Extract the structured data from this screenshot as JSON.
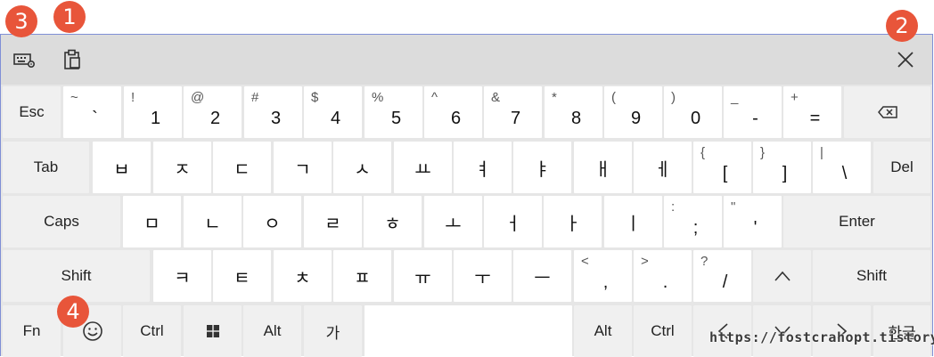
{
  "titlebar": {
    "settings_icon": "keyboard-settings-icon",
    "clipboard_icon": "clipboard-icon",
    "close_icon": "close-icon"
  },
  "badges": [
    "3",
    "1",
    "2",
    "4"
  ],
  "rows": [
    [
      {
        "type": "label",
        "text": "Esc"
      },
      {
        "type": "char",
        "sub": "~",
        "main": "`"
      },
      {
        "type": "char",
        "sub": "!",
        "main": "1"
      },
      {
        "type": "char",
        "sub": "@",
        "main": "2"
      },
      {
        "type": "char",
        "sub": "#",
        "main": "3"
      },
      {
        "type": "char",
        "sub": "$",
        "main": "4"
      },
      {
        "type": "char",
        "sub": "%",
        "main": "5"
      },
      {
        "type": "char",
        "sub": "^",
        "main": "6"
      },
      {
        "type": "char",
        "sub": "&",
        "main": "7"
      },
      {
        "type": "char",
        "sub": "*",
        "main": "8"
      },
      {
        "type": "char",
        "sub": "(",
        "main": "9"
      },
      {
        "type": "char",
        "sub": ")",
        "main": "0"
      },
      {
        "type": "char",
        "sub": "_",
        "main": "-"
      },
      {
        "type": "char",
        "sub": "+",
        "main": "="
      },
      {
        "type": "icon",
        "icon": "backspace-icon"
      }
    ],
    [
      {
        "type": "label",
        "text": "Tab"
      },
      {
        "type": "char",
        "sub": "",
        "main": "ㅂ"
      },
      {
        "type": "char",
        "sub": "",
        "main": "ㅈ"
      },
      {
        "type": "char",
        "sub": "",
        "main": "ㄷ"
      },
      {
        "type": "char",
        "sub": "",
        "main": "ㄱ"
      },
      {
        "type": "char",
        "sub": "",
        "main": "ㅅ"
      },
      {
        "type": "char",
        "sub": "",
        "main": "ㅛ"
      },
      {
        "type": "char",
        "sub": "",
        "main": "ㅕ"
      },
      {
        "type": "char",
        "sub": "",
        "main": "ㅑ"
      },
      {
        "type": "char",
        "sub": "",
        "main": "ㅐ"
      },
      {
        "type": "char",
        "sub": "",
        "main": "ㅔ"
      },
      {
        "type": "char",
        "sub": "{",
        "main": "["
      },
      {
        "type": "char",
        "sub": "}",
        "main": "]"
      },
      {
        "type": "char",
        "sub": "|",
        "main": "\\"
      },
      {
        "type": "label",
        "text": "Del"
      }
    ],
    [
      {
        "type": "label",
        "text": "Caps"
      },
      {
        "type": "char",
        "sub": "",
        "main": "ㅁ"
      },
      {
        "type": "char",
        "sub": "",
        "main": "ㄴ"
      },
      {
        "type": "char",
        "sub": "",
        "main": "ㅇ"
      },
      {
        "type": "char",
        "sub": "",
        "main": "ㄹ"
      },
      {
        "type": "char",
        "sub": "",
        "main": "ㅎ"
      },
      {
        "type": "char",
        "sub": "",
        "main": "ㅗ"
      },
      {
        "type": "char",
        "sub": "",
        "main": "ㅓ"
      },
      {
        "type": "char",
        "sub": "",
        "main": "ㅏ"
      },
      {
        "type": "char",
        "sub": "",
        "main": "ㅣ"
      },
      {
        "type": "char",
        "sub": ":",
        "main": ";"
      },
      {
        "type": "char",
        "sub": "\"",
        "main": "'"
      },
      {
        "type": "label",
        "text": "Enter"
      }
    ],
    [
      {
        "type": "label",
        "text": "Shift"
      },
      {
        "type": "char",
        "sub": "",
        "main": "ㅋ"
      },
      {
        "type": "char",
        "sub": "",
        "main": "ㅌ"
      },
      {
        "type": "char",
        "sub": "",
        "main": "ㅊ"
      },
      {
        "type": "char",
        "sub": "",
        "main": "ㅍ"
      },
      {
        "type": "char",
        "sub": "",
        "main": "ㅠ"
      },
      {
        "type": "char",
        "sub": "",
        "main": "ㅜ"
      },
      {
        "type": "char",
        "sub": "",
        "main": "ㅡ"
      },
      {
        "type": "char",
        "sub": "<",
        "main": ","
      },
      {
        "type": "char",
        "sub": ">",
        "main": "."
      },
      {
        "type": "char",
        "sub": "?",
        "main": "/"
      },
      {
        "type": "icon",
        "icon": "up-arrow-icon"
      },
      {
        "type": "label",
        "text": "Shift"
      }
    ],
    [
      {
        "type": "label",
        "text": "Fn"
      },
      {
        "type": "icon",
        "icon": "emoji-icon"
      },
      {
        "type": "label",
        "text": "Ctrl"
      },
      {
        "type": "icon",
        "icon": "windows-icon"
      },
      {
        "type": "label",
        "text": "Alt"
      },
      {
        "type": "label",
        "text": "가"
      },
      {
        "type": "label",
        "text": ""
      },
      {
        "type": "label",
        "text": "Alt"
      },
      {
        "type": "label",
        "text": "Ctrl"
      },
      {
        "type": "icon",
        "icon": "left-arrow-icon"
      },
      {
        "type": "icon",
        "icon": "down-arrow-icon"
      },
      {
        "type": "icon",
        "icon": "right-arrow-icon"
      },
      {
        "type": "label",
        "text": "한글"
      }
    ]
  ],
  "watermark": "https://fostcrahopt.tistory.com"
}
